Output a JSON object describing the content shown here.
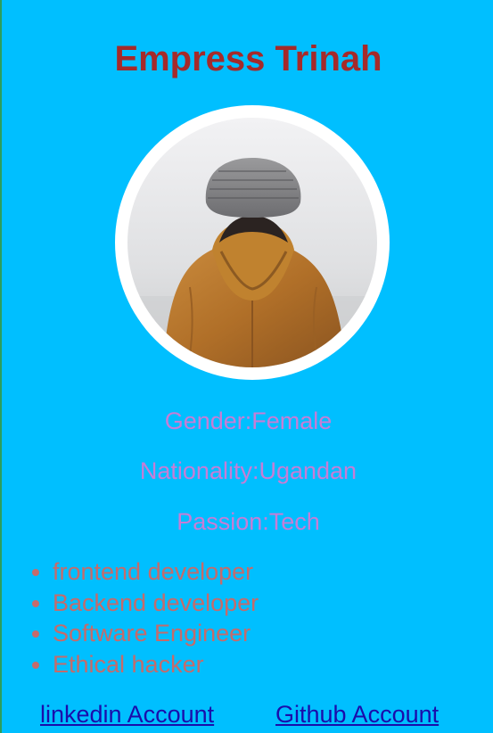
{
  "profile": {
    "name": "Empress Trinah",
    "gender": "Gender:Female",
    "nationality": "Nationality:Ugandan",
    "passion": "Passion:Tech"
  },
  "skills": [
    "frontend developer",
    "Backend developer",
    "Software Engineer",
    "Ethical hacker"
  ],
  "links": {
    "linkedin": "linkedin Account",
    "github": "Github Account"
  },
  "colors": {
    "background": "#00bfff",
    "title": "#a52a2a",
    "info_text": "#c77dd6",
    "skills_text": "#c56b6b",
    "link": "#1a0dab"
  }
}
